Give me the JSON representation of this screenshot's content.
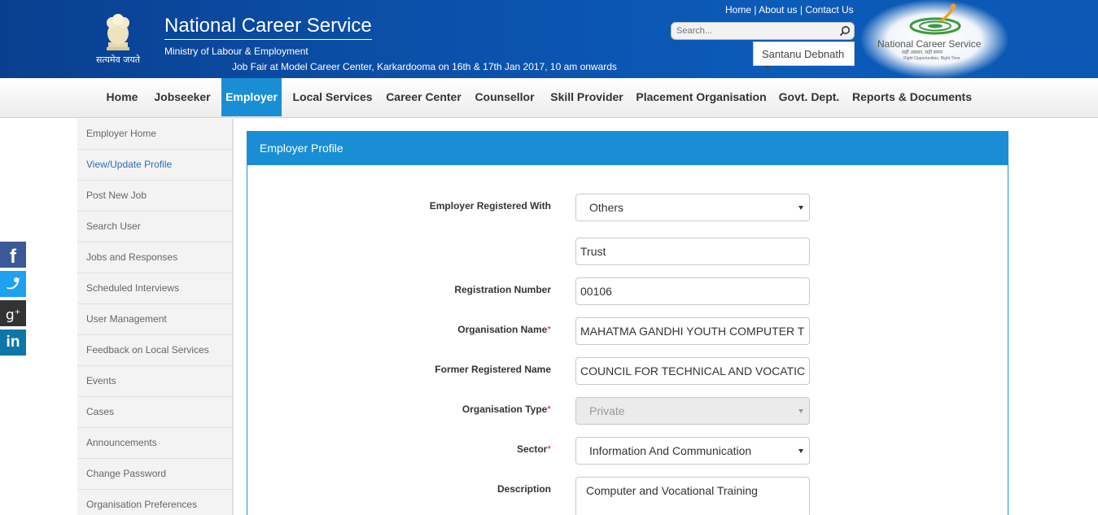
{
  "header": {
    "emblem_motto": "सत्यमेव जयते",
    "site_title": "National Career Service",
    "ministry": "Ministry of Labour & Employment",
    "ticker": "Job Fair at Model Career Center, Karkardooma on 16th & 17th Jan 2017, 10 am onwards",
    "top_links": [
      "Home",
      "About us",
      "Contact Us"
    ],
    "search_placeholder": "Search...",
    "user_name": "Santanu Debnath",
    "logo_text": "National Career Service",
    "logo_sub": "सही अवसर, सही समय",
    "logo_tag": "Right Opportunities, Right Time"
  },
  "nav": {
    "items": [
      "Home",
      "Jobseeker",
      "Employer",
      "Local Services",
      "Career Center",
      "Counsellor",
      "Skill Provider",
      "Placement Organisation",
      "Govt. Dept.",
      "Reports & Documents"
    ],
    "active": "Employer"
  },
  "sidebar": {
    "items": [
      "Employer Home",
      "View/Update Profile",
      "Post New Job",
      "Search User",
      "Jobs and Responses",
      "Scheduled Interviews",
      "User Management",
      "Feedback on Local Services",
      "Events",
      "Cases",
      "Announcements",
      "Change Password",
      "Organisation Preferences"
    ],
    "active": "View/Update Profile"
  },
  "social": [
    "facebook",
    "twitter",
    "google-plus",
    "linkedin"
  ],
  "colors": {
    "header_blue": "#0b4fa8",
    "accent_blue": "#1a8ed4",
    "required_red": "#e02525"
  },
  "form": {
    "title": "Employer Profile",
    "employer_registered_with": {
      "label": "Employer Registered With",
      "value": "Others"
    },
    "registered_with_other": {
      "value": "Trust"
    },
    "registration_number": {
      "label": "Registration Number",
      "value": "00106"
    },
    "organisation_name": {
      "label": "Organisation Name",
      "value": "MAHATMA GANDHI YOUTH COMPUTER T"
    },
    "former_registered_name": {
      "label": "Former Registered Name",
      "value": "COUNCIL FOR TECHNICAL AND VOCATIC"
    },
    "organisation_type": {
      "label": "Organisation Type",
      "value": "Private"
    },
    "sector": {
      "label": "Sector",
      "value": "Information And Communication"
    },
    "description": {
      "label": "Description",
      "value": "Computer and Vocational Training"
    },
    "required_mark": "*"
  }
}
